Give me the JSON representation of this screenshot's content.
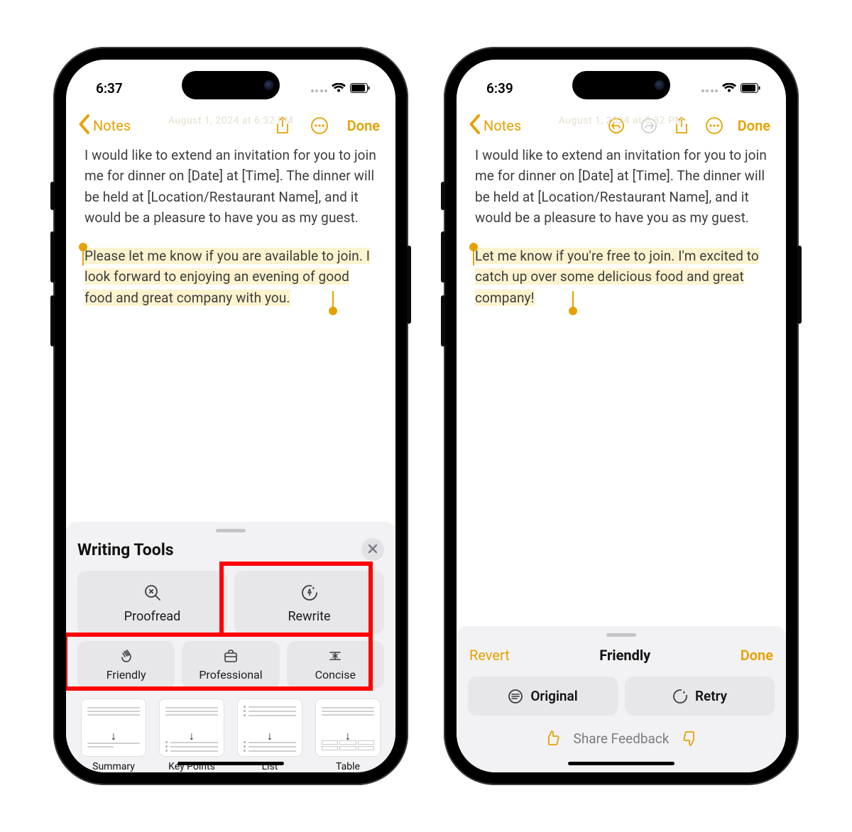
{
  "phones": {
    "left": {
      "time": "6:37",
      "nav": {
        "back_label": "Notes",
        "done_label": "Done",
        "timestamp_ghost": "August 1, 2024 at 6:32 PM"
      },
      "note": {
        "para1": "I would like to extend an invitation for you to join me for dinner on [Date] at [Time]. The dinner will be held at [Location/Restaurant Name], and it would be a pleasure to have you as my guest.",
        "para2": "Please let me know if you are available to join. I look forward to enjoying an evening of good food and great company with you."
      },
      "sheet": {
        "title": "Writing Tools",
        "tools_top": {
          "proofread": "Proofread",
          "rewrite": "Rewrite"
        },
        "tools_mid": {
          "friendly": "Friendly",
          "professional": "Professional",
          "concise": "Concise"
        },
        "minis": {
          "summary": "Summary",
          "keypoints": "Key Points",
          "list": "List",
          "table": "Table"
        }
      }
    },
    "right": {
      "time": "6:39",
      "nav": {
        "back_label": "Notes",
        "done_label": "Done",
        "timestamp_ghost": "August 1, 2024 at 6:32 PM"
      },
      "note": {
        "para1": "I would like to extend an invitation for you to join me for dinner on [Date] at [Time]. The dinner will be held at [Location/Restaurant Name], and it would be a pleasure to have you as my guest.",
        "para2": "Let me know if you're free to join. I'm excited to catch up over some delicious food and great company!"
      },
      "result": {
        "revert": "Revert",
        "mode": "Friendly",
        "done": "Done",
        "original": "Original",
        "retry": "Retry",
        "feedback": "Share Feedback"
      }
    }
  }
}
